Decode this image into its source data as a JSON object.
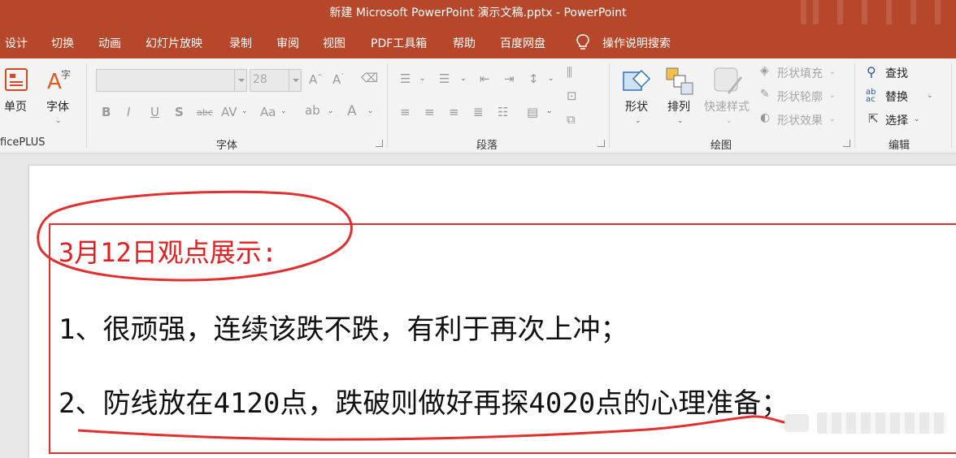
{
  "window": {
    "title": "新建 Microsoft PowerPoint 演示文稿.pptx  -  PowerPoint"
  },
  "menu": {
    "tabs": [
      "设计",
      "切换",
      "动画",
      "幻灯片放映",
      "录制",
      "审阅",
      "视图",
      "PDF工具箱",
      "帮助",
      "百度网盘"
    ],
    "tell_me": "操作说明搜索"
  },
  "ribbon": {
    "slides": {
      "single_label": "单页",
      "plugin_label": "ficePLUS"
    },
    "font": {
      "font_label": "字体",
      "size_value": "28",
      "group_label": "字体"
    },
    "paragraph": {
      "group_label": "段落"
    },
    "drawing": {
      "shapes_label": "形状",
      "arrange_label": "排列",
      "quick_styles_label": "快速样式",
      "fill_label": "形状填充",
      "outline_label": "形状轮廓",
      "effects_label": "形状效果",
      "group_label": "绘图"
    },
    "editing": {
      "find_label": "查找",
      "replace_label": "替换",
      "select_label": "选择",
      "group_label": "编辑"
    }
  },
  "slide": {
    "heading": "3月12日观点展示:",
    "line1": "1、很顽强，连续该跌不跌，有利于再次上冲；",
    "line2": "2、防线放在4120点，跌破则做好再探4020点的心理准备；"
  },
  "colors": {
    "accent": "#b7472a",
    "annotation_red": "#e03030"
  }
}
